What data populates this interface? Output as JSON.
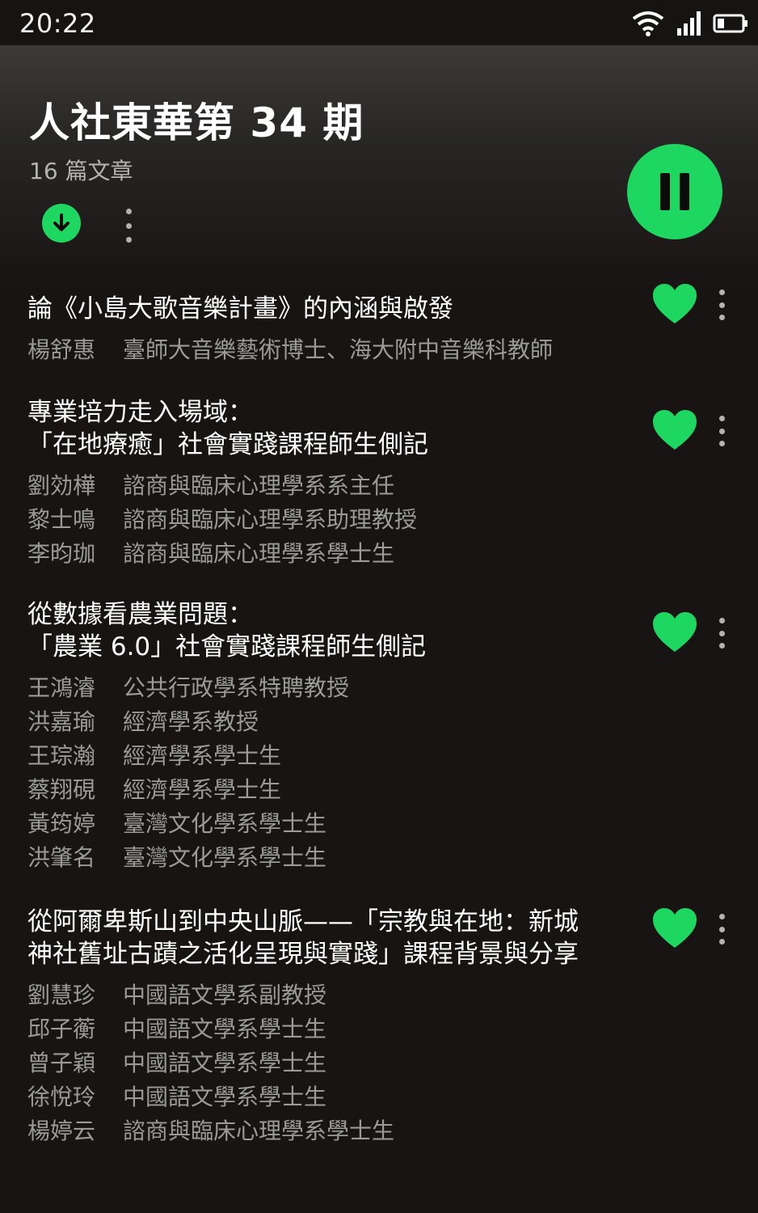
{
  "status_bar": {
    "time": "20:22",
    "icons": [
      "wifi-icon",
      "signal-icon",
      "battery-icon"
    ]
  },
  "header": {
    "title": "人社東華第 34 期",
    "subtitle": "16 篇文章",
    "icons": [
      "download-icon",
      "more-vertical-icon",
      "pause-icon"
    ]
  },
  "articles": [
    {
      "title": "論《小島大歌音樂計畫》的內涵與啟發",
      "liked": true,
      "authors": [
        {
          "name": "楊舒惠",
          "role": "臺師大音樂藝術博士、海大附中音樂科教師"
        }
      ]
    },
    {
      "title": "專業培力走入場域：\n「在地療癒」社會實踐課程師生側記",
      "liked": true,
      "authors": [
        {
          "name": "劉効樺",
          "role": "諮商與臨床心理學系系主任"
        },
        {
          "name": "黎士鳴",
          "role": "諮商與臨床心理學系助理教授"
        },
        {
          "name": "李昀珈",
          "role": "諮商與臨床心理學系學士生"
        }
      ]
    },
    {
      "title": "從數據看農業問題：\n「農業 6.0」社會實踐課程師生側記",
      "liked": true,
      "authors": [
        {
          "name": "王鴻濬",
          "role": "公共行政學系特聘教授"
        },
        {
          "name": "洪嘉瑜",
          "role": "經濟學系教授"
        },
        {
          "name": "王琮瀚",
          "role": "經濟學系學士生"
        },
        {
          "name": "蔡翔硯",
          "role": "經濟學系學士生"
        },
        {
          "name": "黃筠婷",
          "role": "臺灣文化學系學士生"
        },
        {
          "name": "洪肇名",
          "role": "臺灣文化學系學士生"
        }
      ]
    },
    {
      "title": "從阿爾卑斯山到中央山脈——「宗教與在地：新城\n神社舊址古蹟之活化呈現與實踐」課程背景與分享",
      "liked": true,
      "authors": [
        {
          "name": "劉慧珍",
          "role": "中國語文學系副教授"
        },
        {
          "name": "邱子蘅",
          "role": "中國語文學系學士生"
        },
        {
          "name": "曾子穎",
          "role": "中國語文學系學士生"
        },
        {
          "name": "徐悅玲",
          "role": "中國語文學系學士生"
        },
        {
          "name": "楊婷云",
          "role": "諮商與臨床心理學系學士生"
        }
      ]
    }
  ],
  "colors": {
    "accent": "#1ed760",
    "background": "#191414",
    "secondary_text": "#9a9a9a"
  }
}
